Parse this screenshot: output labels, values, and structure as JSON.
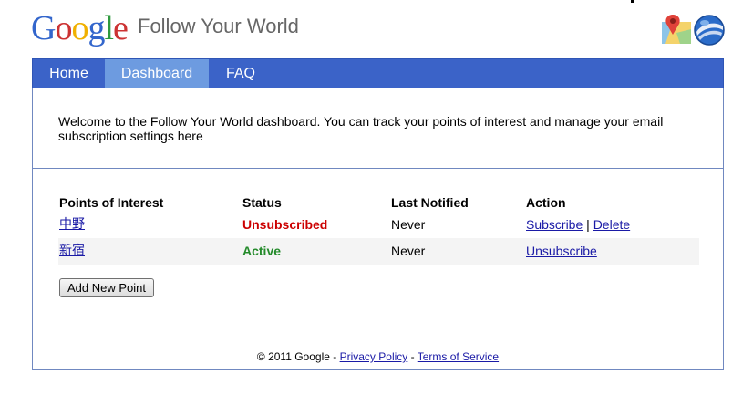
{
  "header": {
    "logo_letters": [
      {
        "ch": "G",
        "color": "#3366cc"
      },
      {
        "ch": "o",
        "color": "#cc3333"
      },
      {
        "ch": "o",
        "color": "#f0b000"
      },
      {
        "ch": "g",
        "color": "#3366cc"
      },
      {
        "ch": "l",
        "color": "#2e9a3e"
      },
      {
        "ch": "e",
        "color": "#cc3333"
      }
    ],
    "title": "Follow Your World",
    "icons": [
      "google-maps-icon",
      "google-earth-icon"
    ]
  },
  "nav": {
    "items": [
      {
        "label": "Home"
      },
      {
        "label": "Dashboard",
        "active": true
      },
      {
        "label": "FAQ"
      }
    ]
  },
  "main": {
    "welcome": "Welcome to the Follow Your World dashboard. You can track your points of interest and manage your email subscription settings here",
    "table": {
      "headers": [
        "Points of Interest",
        "Status",
        "Last Notified",
        "Action"
      ],
      "rows": [
        {
          "point": "中野",
          "status": "Unsubscribed",
          "last_notified": "Never",
          "action_1": "Subscribe",
          "separator": "|",
          "action_2": "Delete"
        },
        {
          "point": "新宿",
          "status": "Active",
          "last_notified": "Never",
          "action_1": "Unsubscribe"
        }
      ]
    },
    "add_button": "Add New Point"
  },
  "footer": {
    "copyright": "© 2011 Google - ",
    "privacy": "Privacy Policy",
    "dash": " - ",
    "terms": "Terms of Service"
  },
  "colors": {
    "nav_bg": "#3b63c8",
    "nav_active": "#6d9be0",
    "status_unsubscribed": "#cc0000",
    "status_active": "#238a2a",
    "link": "#1a1aa6"
  }
}
